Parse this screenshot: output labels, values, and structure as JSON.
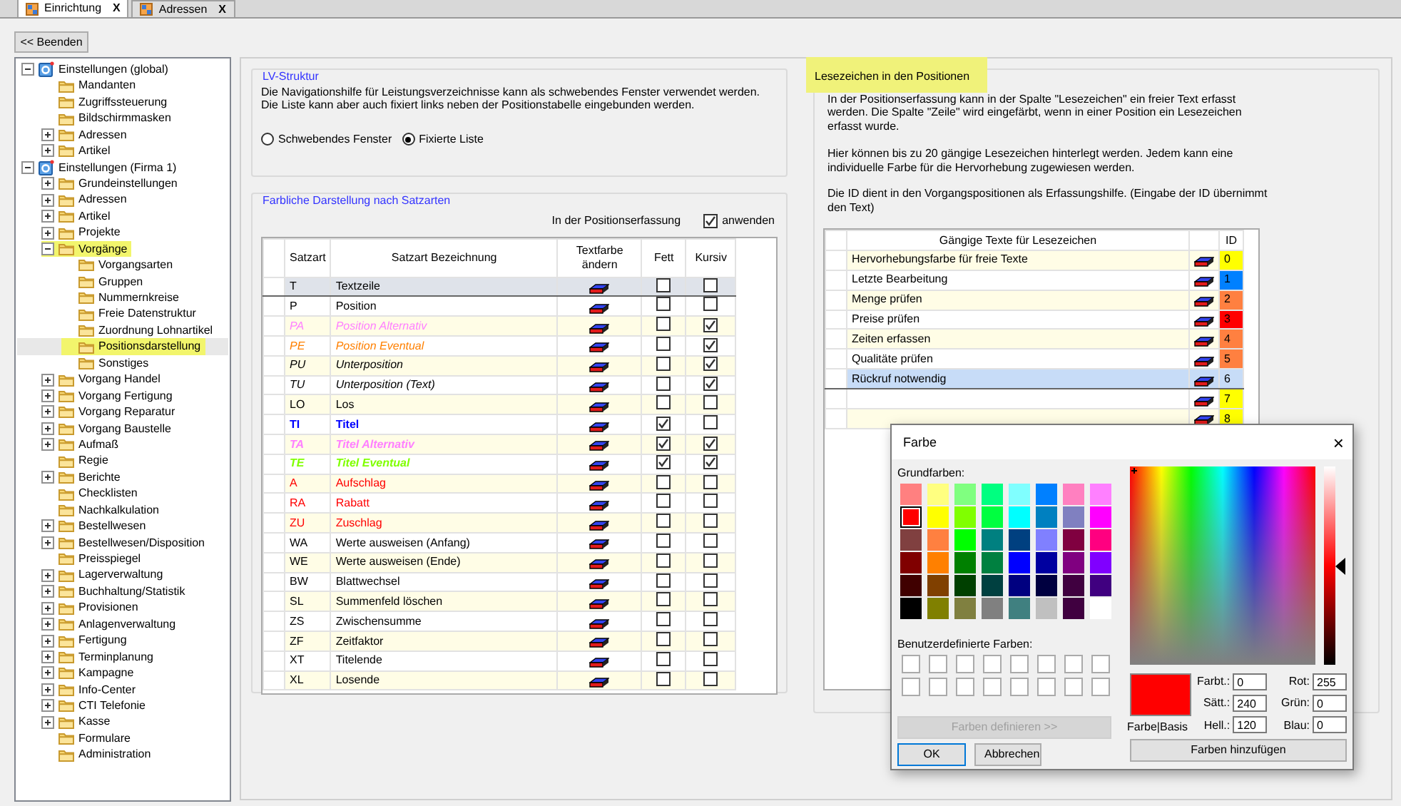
{
  "tabs": [
    {
      "label": "Einrichtung",
      "selected": true,
      "close": "X"
    },
    {
      "label": "Adressen",
      "selected": false,
      "close": "X"
    }
  ],
  "back_button": "<< Beenden",
  "tree": [
    {
      "label": "Einstellungen (global)",
      "kind": "settings",
      "has_children": true,
      "expanded": true,
      "selected": false,
      "highlighted": false,
      "children": [
        {
          "label": "Mandanten",
          "kind": "folder",
          "has_children": false,
          "expanded": false,
          "selected": false,
          "highlighted": false
        },
        {
          "label": "Zugriffssteuerung",
          "kind": "folder",
          "has_children": false,
          "expanded": false,
          "selected": false,
          "highlighted": false
        },
        {
          "label": "Bildschirmmasken",
          "kind": "folder",
          "has_children": false,
          "expanded": false,
          "selected": false,
          "highlighted": false
        },
        {
          "label": "Adressen",
          "kind": "folder",
          "has_children": true,
          "expanded": false,
          "selected": false,
          "highlighted": false
        },
        {
          "label": "Artikel",
          "kind": "folder",
          "has_children": true,
          "expanded": false,
          "selected": false,
          "highlighted": false
        }
      ]
    },
    {
      "label": "Einstellungen (Firma 1)",
      "kind": "settings",
      "has_children": true,
      "expanded": true,
      "selected": false,
      "highlighted": false,
      "children": [
        {
          "label": "Grundeinstellungen",
          "kind": "folder",
          "has_children": true,
          "expanded": false,
          "selected": false,
          "highlighted": false
        },
        {
          "label": "Adressen",
          "kind": "folder",
          "has_children": true,
          "expanded": false,
          "selected": false,
          "highlighted": false
        },
        {
          "label": "Artikel",
          "kind": "folder",
          "has_children": true,
          "expanded": false,
          "selected": false,
          "highlighted": false
        },
        {
          "label": "Projekte",
          "kind": "folder",
          "has_children": true,
          "expanded": false,
          "selected": false,
          "highlighted": false
        },
        {
          "label": "Vorgänge",
          "kind": "folder",
          "has_children": true,
          "expanded": true,
          "selected": false,
          "highlighted": true,
          "children": [
            {
              "label": "Vorgangsarten",
              "kind": "folder",
              "has_children": false,
              "expanded": false,
              "selected": false,
              "highlighted": false
            },
            {
              "label": "Gruppen",
              "kind": "folder",
              "has_children": false,
              "expanded": false,
              "selected": false,
              "highlighted": false
            },
            {
              "label": "Nummernkreise",
              "kind": "folder",
              "has_children": false,
              "expanded": false,
              "selected": false,
              "highlighted": false
            },
            {
              "label": "Freie Datenstruktur",
              "kind": "folder",
              "has_children": false,
              "expanded": false,
              "selected": false,
              "highlighted": false
            },
            {
              "label": "Zuordnung Lohnartikel",
              "kind": "folder",
              "has_children": false,
              "expanded": false,
              "selected": false,
              "highlighted": false
            },
            {
              "label": "Positionsdarstellung",
              "kind": "folder",
              "has_children": false,
              "expanded": false,
              "selected": true,
              "highlighted": true
            },
            {
              "label": "Sonstiges",
              "kind": "folder",
              "has_children": false,
              "expanded": false,
              "selected": false,
              "highlighted": false
            }
          ]
        },
        {
          "label": "Vorgang Handel",
          "kind": "folder",
          "has_children": true,
          "expanded": false,
          "selected": false,
          "highlighted": false
        },
        {
          "label": "Vorgang Fertigung",
          "kind": "folder",
          "has_children": true,
          "expanded": false,
          "selected": false,
          "highlighted": false
        },
        {
          "label": "Vorgang Reparatur",
          "kind": "folder",
          "has_children": true,
          "expanded": false,
          "selected": false,
          "highlighted": false
        },
        {
          "label": "Vorgang Baustelle",
          "kind": "folder",
          "has_children": true,
          "expanded": false,
          "selected": false,
          "highlighted": false
        },
        {
          "label": "Aufmaß",
          "kind": "folder",
          "has_children": true,
          "expanded": false,
          "selected": false,
          "highlighted": false
        },
        {
          "label": "Regie",
          "kind": "folder",
          "has_children": false,
          "expanded": false,
          "selected": false,
          "highlighted": false
        },
        {
          "label": "Berichte",
          "kind": "folder",
          "has_children": true,
          "expanded": false,
          "selected": false,
          "highlighted": false
        },
        {
          "label": "Checklisten",
          "kind": "folder",
          "has_children": false,
          "expanded": false,
          "selected": false,
          "highlighted": false
        },
        {
          "label": "Nachkalkulation",
          "kind": "folder",
          "has_children": false,
          "expanded": false,
          "selected": false,
          "highlighted": false
        },
        {
          "label": "Bestellwesen",
          "kind": "folder",
          "has_children": true,
          "expanded": false,
          "selected": false,
          "highlighted": false
        },
        {
          "label": "Bestellwesen/Disposition",
          "kind": "folder",
          "has_children": true,
          "expanded": false,
          "selected": false,
          "highlighted": false
        },
        {
          "label": "Preisspiegel",
          "kind": "folder",
          "has_children": false,
          "expanded": false,
          "selected": false,
          "highlighted": false
        },
        {
          "label": "Lagerverwaltung",
          "kind": "folder",
          "has_children": true,
          "expanded": false,
          "selected": false,
          "highlighted": false
        },
        {
          "label": "Buchhaltung/Statistik",
          "kind": "folder",
          "has_children": true,
          "expanded": false,
          "selected": false,
          "highlighted": false
        },
        {
          "label": "Provisionen",
          "kind": "folder",
          "has_children": true,
          "expanded": false,
          "selected": false,
          "highlighted": false
        },
        {
          "label": "Anlagenverwaltung",
          "kind": "folder",
          "has_children": true,
          "expanded": false,
          "selected": false,
          "highlighted": false
        },
        {
          "label": "Fertigung",
          "kind": "folder",
          "has_children": true,
          "expanded": false,
          "selected": false,
          "highlighted": false
        },
        {
          "label": "Terminplanung",
          "kind": "folder",
          "has_children": true,
          "expanded": false,
          "selected": false,
          "highlighted": false
        },
        {
          "label": "Kampagne",
          "kind": "folder",
          "has_children": true,
          "expanded": false,
          "selected": false,
          "highlighted": false
        },
        {
          "label": "Info-Center",
          "kind": "folder",
          "has_children": true,
          "expanded": false,
          "selected": false,
          "highlighted": false
        },
        {
          "label": "CTI Telefonie",
          "kind": "folder",
          "has_children": true,
          "expanded": false,
          "selected": false,
          "highlighted": false
        },
        {
          "label": "Kasse",
          "kind": "folder",
          "has_children": true,
          "expanded": false,
          "selected": false,
          "highlighted": false
        },
        {
          "label": "Formulare",
          "kind": "folder",
          "has_children": false,
          "expanded": false,
          "selected": false,
          "highlighted": false
        },
        {
          "label": "Administration",
          "kind": "folder",
          "has_children": false,
          "expanded": false,
          "selected": false,
          "highlighted": false
        }
      ]
    }
  ],
  "lv_struktur": {
    "title": "LV-Struktur",
    "text_lines": [
      "Die Navigationshilfe für Leistungsverzeichnisse kann als schwebendes Fenster verwendet werden.",
      "Die Liste kann aber auch fixiert links neben der Positionstabelle eingebunden werden."
    ],
    "options": [
      {
        "label": "Schwebendes Fenster",
        "selected": false
      },
      {
        "label": "Fixierte Liste",
        "selected": true
      }
    ]
  },
  "satzarten": {
    "title": "Farbliche Darstellung nach Satzarten",
    "apply_label": "In der Positionserfassung",
    "apply_checkbox": {
      "label": "anwenden",
      "checked": true
    },
    "columns": [
      "Satzart",
      "Satzart Bezeichnung",
      "Textfarbe ändern",
      "Fett",
      "Kursiv"
    ],
    "rows": [
      {
        "code": "T",
        "name": "Textzeile",
        "color": "#000000",
        "bold": false,
        "italic": false,
        "selected": true
      },
      {
        "code": "P",
        "name": "Position",
        "color": "#000000",
        "bold": false,
        "italic": false,
        "selected": false
      },
      {
        "code": "PA",
        "name": "Position Alternativ",
        "color": "#ff80ff",
        "bold": false,
        "italic": true,
        "selected": false
      },
      {
        "code": "PE",
        "name": "Position Eventual",
        "color": "#ff8000",
        "bold": false,
        "italic": true,
        "selected": false
      },
      {
        "code": "PU",
        "name": "Unterposition",
        "color": "#000000",
        "bold": false,
        "italic": true,
        "selected": false
      },
      {
        "code": "TU",
        "name": "Unterposition (Text)",
        "color": "#000000",
        "bold": false,
        "italic": true,
        "selected": false
      },
      {
        "code": "LO",
        "name": "Los",
        "color": "#000000",
        "bold": false,
        "italic": false,
        "selected": false
      },
      {
        "code": "TI",
        "name": "Titel",
        "color": "#0000ff",
        "bold": true,
        "italic": false,
        "selected": false
      },
      {
        "code": "TA",
        "name": "Titel Alternativ",
        "color": "#ff80ff",
        "bold": true,
        "italic": true,
        "selected": false
      },
      {
        "code": "TE",
        "name": "Titel Eventual",
        "color": "#80ff00",
        "bold": true,
        "italic": true,
        "selected": false
      },
      {
        "code": "A",
        "name": "Aufschlag",
        "color": "#ff0000",
        "bold": false,
        "italic": false,
        "selected": false
      },
      {
        "code": "RA",
        "name": "Rabatt",
        "color": "#ff0000",
        "bold": false,
        "italic": false,
        "selected": false
      },
      {
        "code": "ZU",
        "name": "Zuschlag",
        "color": "#ff0000",
        "bold": false,
        "italic": false,
        "selected": false
      },
      {
        "code": "WA",
        "name": "Werte ausweisen (Anfang)",
        "color": "#000000",
        "bold": false,
        "italic": false,
        "selected": false
      },
      {
        "code": "WE",
        "name": "Werte ausweisen (Ende)",
        "color": "#000000",
        "bold": false,
        "italic": false,
        "selected": false
      },
      {
        "code": "BW",
        "name": "Blattwechsel",
        "color": "#000000",
        "bold": false,
        "italic": false,
        "selected": false
      },
      {
        "code": "SL",
        "name": "Summenfeld löschen",
        "color": "#000000",
        "bold": false,
        "italic": false,
        "selected": false
      },
      {
        "code": "ZS",
        "name": "Zwischensumme",
        "color": "#000000",
        "bold": false,
        "italic": false,
        "selected": false
      },
      {
        "code": "ZF",
        "name": "Zeitfaktor",
        "color": "#000000",
        "bold": false,
        "italic": false,
        "selected": false
      },
      {
        "code": "XT",
        "name": "Titelende",
        "color": "#000000",
        "bold": false,
        "italic": false,
        "selected": false
      },
      {
        "code": "XL",
        "name": "Losende",
        "color": "#000000",
        "bold": false,
        "italic": false,
        "selected": false
      }
    ]
  },
  "lesezeichen": {
    "title": "Lesezeichen in den Positionen",
    "highlighted": true,
    "paragraphs": [
      "In der Positionserfassung kann in der Spalte \"Lesezeichen\" ein freier Text erfasst werden. Die Spalte \"Zeile\" wird eingefärbt, wenn in einer Position ein Lesezeichen erfasst wurde.",
      "Hier können bis zu 20 gängige Lesezeichen hinterlegt werden. Jedem kann eine individuelle Farbe für die Hervorhebung zugewiesen werden.",
      "Die ID dient in den Vorgangspositionen als Erfassungshilfe. (Eingabe der ID übernimmt den Text)"
    ],
    "columns": [
      "Gängige Texte für Lesezeichen",
      "ID"
    ],
    "rows": [
      {
        "text": "Hervorhebungsfarbe für freie Texte",
        "id": "0",
        "color": "#ffff00",
        "selected": false
      },
      {
        "text": "Letzte Bearbeitung",
        "id": "1",
        "color": "#0080ff",
        "selected": false
      },
      {
        "text": "Menge prüfen",
        "id": "2",
        "color": "#ff8040",
        "selected": false
      },
      {
        "text": "Preise prüfen",
        "id": "3",
        "color": "#ff0000",
        "selected": false
      },
      {
        "text": "Zeiten erfassen",
        "id": "4",
        "color": "#ff8040",
        "selected": false
      },
      {
        "text": "Qualitäte prüfen",
        "id": "5",
        "color": "#ff8040",
        "selected": false
      },
      {
        "text": "Rückruf notwendig",
        "id": "6",
        "selected": true
      },
      {
        "id": "7",
        "color": "#ffff00",
        "selected": false
      },
      {
        "id": "8",
        "color": "#ffff00",
        "selected": false
      }
    ]
  },
  "dialog": {
    "title": "Farbe",
    "close": "×",
    "basic_label": "Grundfarben:",
    "basic_colors": [
      {
        "color": "#ff8080",
        "selected": false
      },
      {
        "color": "#ffff80",
        "selected": false
      },
      {
        "color": "#80ff80",
        "selected": false
      },
      {
        "color": "#00ff80",
        "selected": false
      },
      {
        "color": "#80ffff",
        "selected": false
      },
      {
        "color": "#0080ff",
        "selected": false
      },
      {
        "color": "#ff80c0",
        "selected": false
      },
      {
        "color": "#ff80ff",
        "selected": false
      },
      {
        "color": "#ff0000",
        "selected": true
      },
      {
        "color": "#ffff00",
        "selected": false
      },
      {
        "color": "#80ff00",
        "selected": false
      },
      {
        "color": "#00ff40",
        "selected": false
      },
      {
        "color": "#00ffff",
        "selected": false
      },
      {
        "color": "#0080c0",
        "selected": false
      },
      {
        "color": "#8080c0",
        "selected": false
      },
      {
        "color": "#ff00ff",
        "selected": false
      },
      {
        "color": "#804040",
        "selected": false
      },
      {
        "color": "#ff8040",
        "selected": false
      },
      {
        "color": "#00ff00",
        "selected": false
      },
      {
        "color": "#008080",
        "selected": false
      },
      {
        "color": "#004080",
        "selected": false
      },
      {
        "color": "#8080ff",
        "selected": false
      },
      {
        "color": "#800040",
        "selected": false
      },
      {
        "color": "#ff0080",
        "selected": false
      },
      {
        "color": "#800000",
        "selected": false
      },
      {
        "color": "#ff8000",
        "selected": false
      },
      {
        "color": "#008000",
        "selected": false
      },
      {
        "color": "#008040",
        "selected": false
      },
      {
        "color": "#0000ff",
        "selected": false
      },
      {
        "color": "#0000a0",
        "selected": false
      },
      {
        "color": "#800080",
        "selected": false
      },
      {
        "color": "#8000ff",
        "selected": false
      },
      {
        "color": "#400000",
        "selected": false
      },
      {
        "color": "#804000",
        "selected": false
      },
      {
        "color": "#004000",
        "selected": false
      },
      {
        "color": "#004040",
        "selected": false
      },
      {
        "color": "#000080",
        "selected": false
      },
      {
        "color": "#000040",
        "selected": false
      },
      {
        "color": "#400040",
        "selected": false
      },
      {
        "color": "#400080",
        "selected": false
      },
      {
        "color": "#000000",
        "selected": false
      },
      {
        "color": "#808000",
        "selected": false
      },
      {
        "color": "#808040",
        "selected": false
      },
      {
        "color": "#808080",
        "selected": false
      },
      {
        "color": "#408080",
        "selected": false
      },
      {
        "color": "#c0c0c0",
        "selected": false
      },
      {
        "color": "#400040",
        "selected": false
      },
      {
        "color": "#ffffff",
        "selected": false
      }
    ],
    "custom_label": "Benutzerdefinierte Farben:",
    "define_button": {
      "label": "Farben definieren >>",
      "disabled": true
    },
    "ok_button": "OK",
    "cancel_button": "Abbrechen",
    "luminance": {
      "level": 0.5
    },
    "preview": {
      "color": "#ff0000",
      "label": "Farbe|Basis"
    },
    "fields": [
      {
        "label": "Farbt.:",
        "value": "0"
      },
      {
        "label": "Rot:",
        "value": "255"
      },
      {
        "label": "Sätt.:",
        "value": "240"
      },
      {
        "label": "Grün:",
        "value": "0"
      },
      {
        "label": "Hell.:",
        "value": "120"
      },
      {
        "label": "Blau:",
        "value": "0"
      }
    ],
    "add_button": "Farben hinzufügen"
  }
}
